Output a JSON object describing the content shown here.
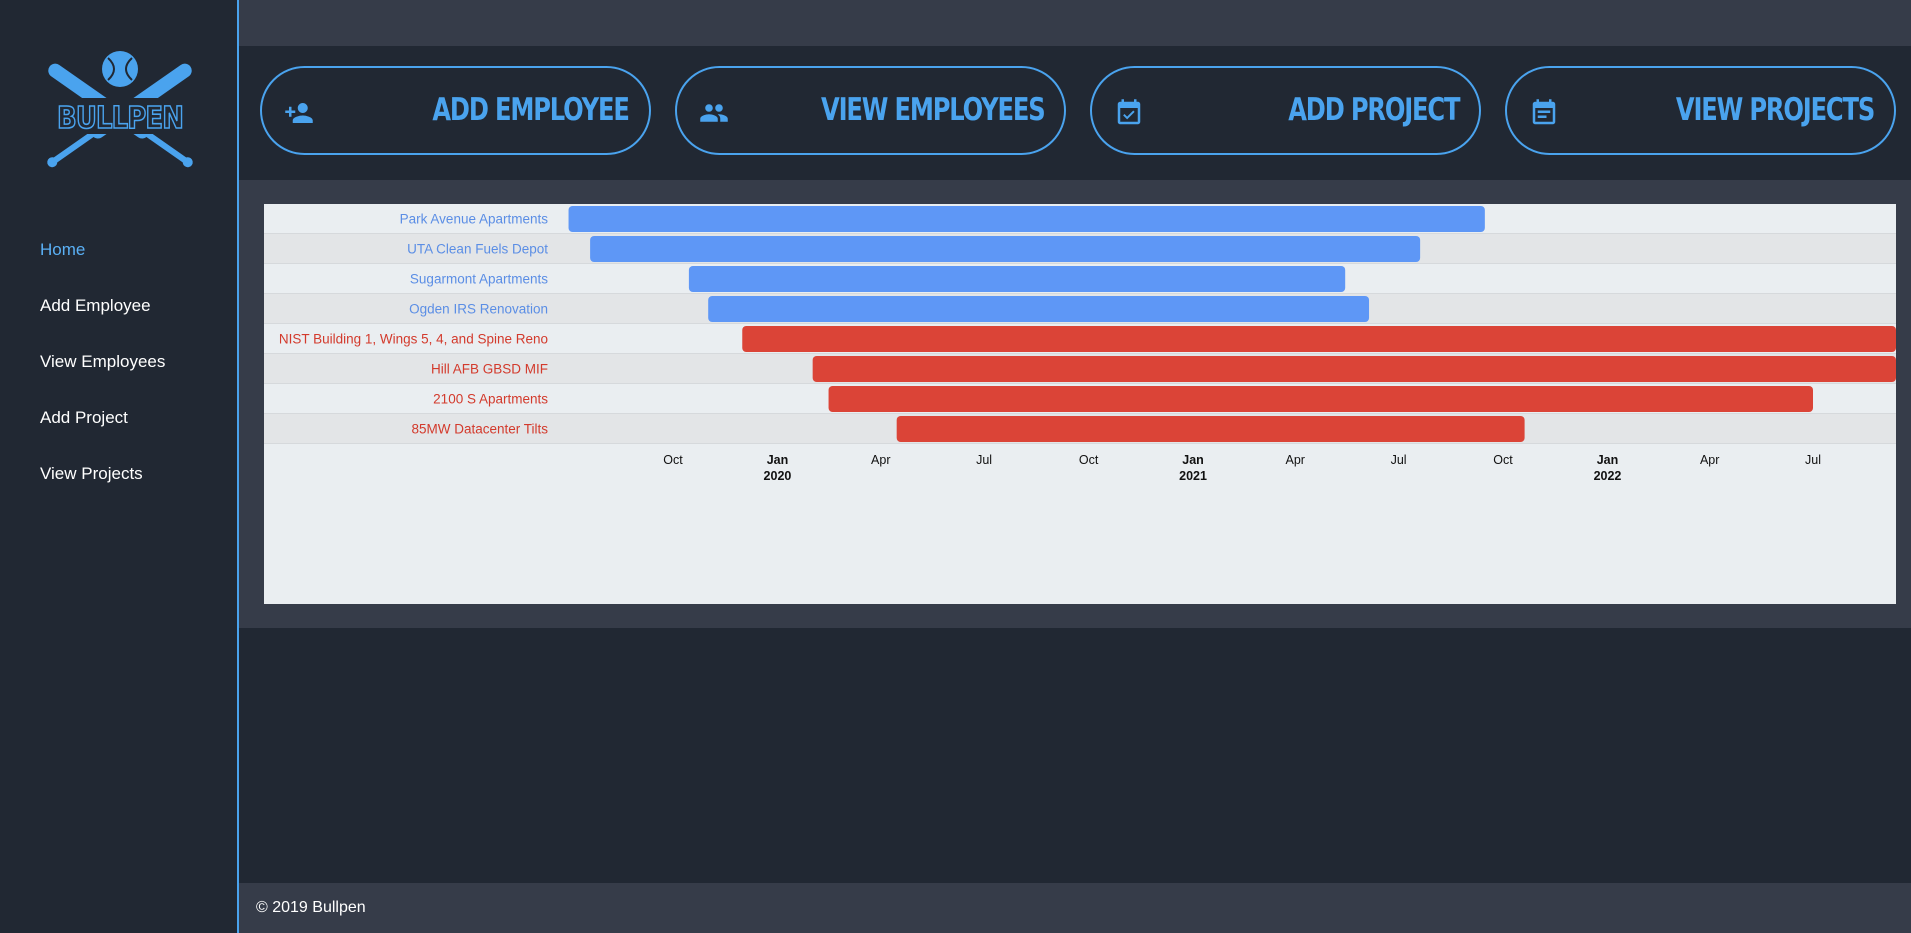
{
  "brand": {
    "logo_text": "BULLPEN"
  },
  "nav": {
    "items": [
      {
        "label": "Home",
        "active": true
      },
      {
        "label": "Add Employee",
        "active": false
      },
      {
        "label": "View Employees",
        "active": false
      },
      {
        "label": "Add Project",
        "active": false
      },
      {
        "label": "View Projects",
        "active": false
      }
    ]
  },
  "actions": [
    {
      "label": "ADD EMPLOYEE",
      "icon": "person-add-icon"
    },
    {
      "label": "VIEW EMPLOYEES",
      "icon": "people-icon"
    },
    {
      "label": "ADD PROJECT",
      "icon": "calendar-check-icon"
    },
    {
      "label": "VIEW PROJECTS",
      "icon": "calendar-list-icon"
    }
  ],
  "colors": {
    "accent": "#4aa3ee",
    "bar_blue": "#5e97f6",
    "bar_red": "#db4437",
    "label_blue": "#5b8ee5",
    "label_red": "#d33a2c"
  },
  "chart_data": {
    "type": "timeline",
    "rows": [
      {
        "label": "Park Avenue Apartments",
        "start": "2019-07-01",
        "end": "2021-09-15",
        "color": "blue"
      },
      {
        "label": "UTA Clean Fuels Depot",
        "start": "2019-07-20",
        "end": "2021-07-20",
        "color": "blue"
      },
      {
        "label": "Sugarmont Apartments",
        "start": "2019-10-15",
        "end": "2021-05-15",
        "color": "blue"
      },
      {
        "label": "Ogden IRS Renovation",
        "start": "2019-11-01",
        "end": "2021-06-05",
        "color": "blue"
      },
      {
        "label": "NIST Building 1, Wings 5, 4, and Spine Reno",
        "start": "2019-12-01",
        "end": "2022-09-15",
        "color": "red"
      },
      {
        "label": "Hill AFB GBSD MIF",
        "start": "2020-02-01",
        "end": "2022-10-01",
        "color": "red"
      },
      {
        "label": "2100 S Apartments",
        "start": "2020-02-15",
        "end": "2022-07-01",
        "color": "red"
      },
      {
        "label": "85MW Datacenter Tilts",
        "start": "2020-04-15",
        "end": "2021-10-20",
        "color": "red"
      }
    ],
    "x_ticks": [
      {
        "date": "2019-10-01",
        "label": "Oct",
        "year": ""
      },
      {
        "date": "2020-01-01",
        "label": "Jan",
        "year": "2020"
      },
      {
        "date": "2020-04-01",
        "label": "Apr",
        "year": ""
      },
      {
        "date": "2020-07-01",
        "label": "Jul",
        "year": ""
      },
      {
        "date": "2020-10-01",
        "label": "Oct",
        "year": ""
      },
      {
        "date": "2021-01-01",
        "label": "Jan",
        "year": "2021"
      },
      {
        "date": "2021-04-01",
        "label": "Apr",
        "year": ""
      },
      {
        "date": "2021-07-01",
        "label": "Jul",
        "year": ""
      },
      {
        "date": "2021-10-01",
        "label": "Oct",
        "year": ""
      },
      {
        "date": "2022-01-01",
        "label": "Jan",
        "year": "2022"
      },
      {
        "date": "2022-04-01",
        "label": "Apr",
        "year": ""
      },
      {
        "date": "2022-07-01",
        "label": "Jul",
        "year": ""
      }
    ]
  },
  "footer": {
    "text": "© 2019 Bullpen"
  }
}
